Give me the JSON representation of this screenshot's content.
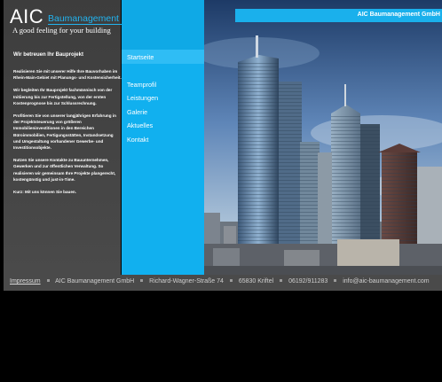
{
  "logo": {
    "name": "AIC",
    "sub": "Baumanagement",
    "tagline": "A good feeling for your building"
  },
  "banner": {
    "title": "AIC Baumanagement GmbH"
  },
  "sidebar": {
    "heading": "Wir betreuen Ihr Bauprojekt",
    "paragraphs": [
      "Realisieren Sie mit unserer Hilfe Ihre Bauvorhaben im Rhein-Main-Gebiet mit Planungs- und Kostensicherheit.",
      "Wir begleiten Ihr Bauprojekt fachmännisch von der Initiierung bis zur Fertigstellung, von der ersten Kostenprognose bis zur Schlussrechnung.",
      "Profitieren Sie von unserer langjährigen Erfahrung in der Projektsteuerung von größeren Immobilieninvestitionen in den Bereichen Büroimmobilien, Fertigungsstätten, Instandsetzung und Umgestaltung vorhandener Gewerbe- und Investitionsobjekte.",
      "Nutzen Sie unsere Kontakte zu Bauunternehmen, Gewerken und zur öffentlichen Verwaltung. So realisieren wir gemeinsam Ihre Projekte plangerecht, kostengünstig und just-in-Time.",
      "Kurz: Mit uns können Sie bauen."
    ]
  },
  "nav": {
    "items": [
      "Startseite",
      "Teamprofil",
      "Leistungen",
      "Galerie",
      "Aktuelles",
      "Kontakt"
    ]
  },
  "footer": {
    "impressum": "Impressum",
    "company": "AIC Baumanagement GmbH",
    "street": "Richard-Wagner-Straße 74",
    "city": "65830 Kriftel",
    "phone": "06192/911283",
    "email": "info@aic-baumanagement.com"
  },
  "colors": {
    "accent": "#11b0ef",
    "panel": "#444444",
    "background": "#000000"
  }
}
